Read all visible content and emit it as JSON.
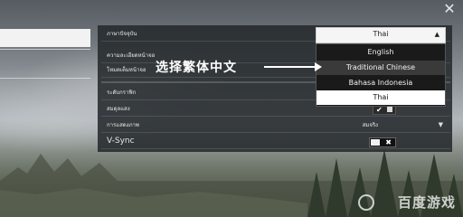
{
  "window": {
    "close_glyph": "✕"
  },
  "settings": {
    "rows": [
      {
        "label": "ภาษาปัจจุบัน"
      },
      {
        "label": "ความละเอียดหน้าจอ"
      },
      {
        "label": "โหมดเต็มหน้าจอ"
      },
      {
        "label": "ระดับกราฟิก"
      },
      {
        "label": "สมดุลแสง"
      },
      {
        "label": "การแสดงภาพ",
        "value": "สมจริง"
      },
      {
        "label": "V-Sync"
      }
    ],
    "caret_glyph": "▼",
    "check_glyph": "✔",
    "x_glyph": "✖"
  },
  "language_dropdown": {
    "current": "Thai",
    "caret": "▲",
    "options": [
      "English",
      "Traditional Chinese",
      "Bahasa Indonesia",
      "Thai"
    ],
    "highlighted_index": 1,
    "selected_index": 3
  },
  "annotation": {
    "text": "选择繁体中文"
  },
  "watermark": {
    "text": "百度游戏"
  }
}
